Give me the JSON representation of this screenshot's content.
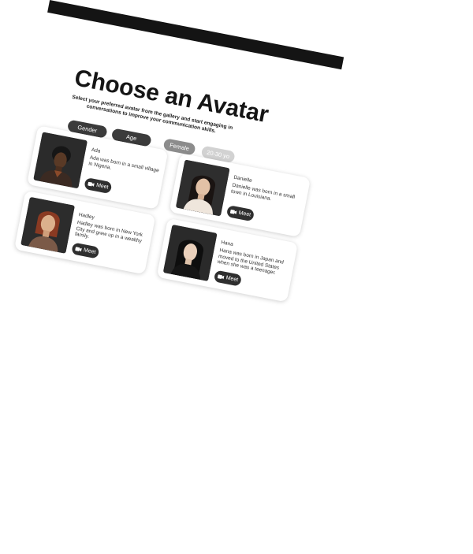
{
  "page": {
    "title": "Choose an Avatar",
    "subtitle": "Select your preferred avatar from the gallery and start engaging in conversations to improve your communication skills."
  },
  "filters": [
    {
      "label": "Gender",
      "style": "dark"
    },
    {
      "label": "Age",
      "style": "dark"
    },
    {
      "label": "Female",
      "style": "selected"
    },
    {
      "label": "20-30 yo",
      "style": "light"
    }
  ],
  "avatars": [
    {
      "name": "Ada",
      "bio": "Ada was born in a small village in Nigeria.",
      "button": "Meet"
    },
    {
      "name": "Danielle",
      "bio": "Danielle was born in a small town in Louisiana.",
      "button": "Meet"
    },
    {
      "name": "Hadley",
      "bio": "Hadley was born in New York City and grew up in a wealthy family.",
      "button": "Meet"
    },
    {
      "name": "Hana",
      "bio": "Hana was born in Japan and moved to the United States when she was a teenager.",
      "button": "Meet"
    }
  ],
  "icons": {
    "meet": "video-camera-icon"
  },
  "colors": {
    "button": "#2f2f2f",
    "chip_dark": "#3b3b3b",
    "chip_selected": "#8c8c8c",
    "chip_light": "#d2d2d2",
    "text": "#151515"
  }
}
